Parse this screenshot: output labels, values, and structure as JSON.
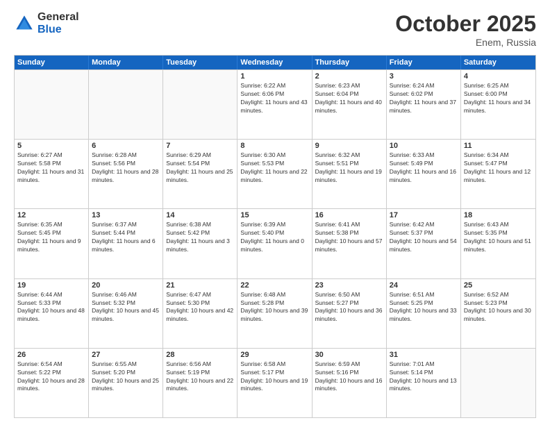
{
  "logo": {
    "general": "General",
    "blue": "Blue"
  },
  "title": "October 2025",
  "location": "Enem, Russia",
  "header_days": [
    "Sunday",
    "Monday",
    "Tuesday",
    "Wednesday",
    "Thursday",
    "Friday",
    "Saturday"
  ],
  "rows": [
    [
      {
        "day": "",
        "sunrise": "",
        "sunset": "",
        "daylight": "",
        "empty": true
      },
      {
        "day": "",
        "sunrise": "",
        "sunset": "",
        "daylight": "",
        "empty": true
      },
      {
        "day": "",
        "sunrise": "",
        "sunset": "",
        "daylight": "",
        "empty": true
      },
      {
        "day": "1",
        "sunrise": "Sunrise: 6:22 AM",
        "sunset": "Sunset: 6:06 PM",
        "daylight": "Daylight: 11 hours and 43 minutes."
      },
      {
        "day": "2",
        "sunrise": "Sunrise: 6:23 AM",
        "sunset": "Sunset: 6:04 PM",
        "daylight": "Daylight: 11 hours and 40 minutes."
      },
      {
        "day": "3",
        "sunrise": "Sunrise: 6:24 AM",
        "sunset": "Sunset: 6:02 PM",
        "daylight": "Daylight: 11 hours and 37 minutes."
      },
      {
        "day": "4",
        "sunrise": "Sunrise: 6:25 AM",
        "sunset": "Sunset: 6:00 PM",
        "daylight": "Daylight: 11 hours and 34 minutes."
      }
    ],
    [
      {
        "day": "5",
        "sunrise": "Sunrise: 6:27 AM",
        "sunset": "Sunset: 5:58 PM",
        "daylight": "Daylight: 11 hours and 31 minutes."
      },
      {
        "day": "6",
        "sunrise": "Sunrise: 6:28 AM",
        "sunset": "Sunset: 5:56 PM",
        "daylight": "Daylight: 11 hours and 28 minutes."
      },
      {
        "day": "7",
        "sunrise": "Sunrise: 6:29 AM",
        "sunset": "Sunset: 5:54 PM",
        "daylight": "Daylight: 11 hours and 25 minutes."
      },
      {
        "day": "8",
        "sunrise": "Sunrise: 6:30 AM",
        "sunset": "Sunset: 5:53 PM",
        "daylight": "Daylight: 11 hours and 22 minutes."
      },
      {
        "day": "9",
        "sunrise": "Sunrise: 6:32 AM",
        "sunset": "Sunset: 5:51 PM",
        "daylight": "Daylight: 11 hours and 19 minutes."
      },
      {
        "day": "10",
        "sunrise": "Sunrise: 6:33 AM",
        "sunset": "Sunset: 5:49 PM",
        "daylight": "Daylight: 11 hours and 16 minutes."
      },
      {
        "day": "11",
        "sunrise": "Sunrise: 6:34 AM",
        "sunset": "Sunset: 5:47 PM",
        "daylight": "Daylight: 11 hours and 12 minutes."
      }
    ],
    [
      {
        "day": "12",
        "sunrise": "Sunrise: 6:35 AM",
        "sunset": "Sunset: 5:45 PM",
        "daylight": "Daylight: 11 hours and 9 minutes."
      },
      {
        "day": "13",
        "sunrise": "Sunrise: 6:37 AM",
        "sunset": "Sunset: 5:44 PM",
        "daylight": "Daylight: 11 hours and 6 minutes."
      },
      {
        "day": "14",
        "sunrise": "Sunrise: 6:38 AM",
        "sunset": "Sunset: 5:42 PM",
        "daylight": "Daylight: 11 hours and 3 minutes."
      },
      {
        "day": "15",
        "sunrise": "Sunrise: 6:39 AM",
        "sunset": "Sunset: 5:40 PM",
        "daylight": "Daylight: 11 hours and 0 minutes."
      },
      {
        "day": "16",
        "sunrise": "Sunrise: 6:41 AM",
        "sunset": "Sunset: 5:38 PM",
        "daylight": "Daylight: 10 hours and 57 minutes."
      },
      {
        "day": "17",
        "sunrise": "Sunrise: 6:42 AM",
        "sunset": "Sunset: 5:37 PM",
        "daylight": "Daylight: 10 hours and 54 minutes."
      },
      {
        "day": "18",
        "sunrise": "Sunrise: 6:43 AM",
        "sunset": "Sunset: 5:35 PM",
        "daylight": "Daylight: 10 hours and 51 minutes."
      }
    ],
    [
      {
        "day": "19",
        "sunrise": "Sunrise: 6:44 AM",
        "sunset": "Sunset: 5:33 PM",
        "daylight": "Daylight: 10 hours and 48 minutes."
      },
      {
        "day": "20",
        "sunrise": "Sunrise: 6:46 AM",
        "sunset": "Sunset: 5:32 PM",
        "daylight": "Daylight: 10 hours and 45 minutes."
      },
      {
        "day": "21",
        "sunrise": "Sunrise: 6:47 AM",
        "sunset": "Sunset: 5:30 PM",
        "daylight": "Daylight: 10 hours and 42 minutes."
      },
      {
        "day": "22",
        "sunrise": "Sunrise: 6:48 AM",
        "sunset": "Sunset: 5:28 PM",
        "daylight": "Daylight: 10 hours and 39 minutes."
      },
      {
        "day": "23",
        "sunrise": "Sunrise: 6:50 AM",
        "sunset": "Sunset: 5:27 PM",
        "daylight": "Daylight: 10 hours and 36 minutes."
      },
      {
        "day": "24",
        "sunrise": "Sunrise: 6:51 AM",
        "sunset": "Sunset: 5:25 PM",
        "daylight": "Daylight: 10 hours and 33 minutes."
      },
      {
        "day": "25",
        "sunrise": "Sunrise: 6:52 AM",
        "sunset": "Sunset: 5:23 PM",
        "daylight": "Daylight: 10 hours and 30 minutes."
      }
    ],
    [
      {
        "day": "26",
        "sunrise": "Sunrise: 6:54 AM",
        "sunset": "Sunset: 5:22 PM",
        "daylight": "Daylight: 10 hours and 28 minutes."
      },
      {
        "day": "27",
        "sunrise": "Sunrise: 6:55 AM",
        "sunset": "Sunset: 5:20 PM",
        "daylight": "Daylight: 10 hours and 25 minutes."
      },
      {
        "day": "28",
        "sunrise": "Sunrise: 6:56 AM",
        "sunset": "Sunset: 5:19 PM",
        "daylight": "Daylight: 10 hours and 22 minutes."
      },
      {
        "day": "29",
        "sunrise": "Sunrise: 6:58 AM",
        "sunset": "Sunset: 5:17 PM",
        "daylight": "Daylight: 10 hours and 19 minutes."
      },
      {
        "day": "30",
        "sunrise": "Sunrise: 6:59 AM",
        "sunset": "Sunset: 5:16 PM",
        "daylight": "Daylight: 10 hours and 16 minutes."
      },
      {
        "day": "31",
        "sunrise": "Sunrise: 7:01 AM",
        "sunset": "Sunset: 5:14 PM",
        "daylight": "Daylight: 10 hours and 13 minutes."
      },
      {
        "day": "",
        "sunrise": "",
        "sunset": "",
        "daylight": "",
        "empty": true
      }
    ]
  ]
}
